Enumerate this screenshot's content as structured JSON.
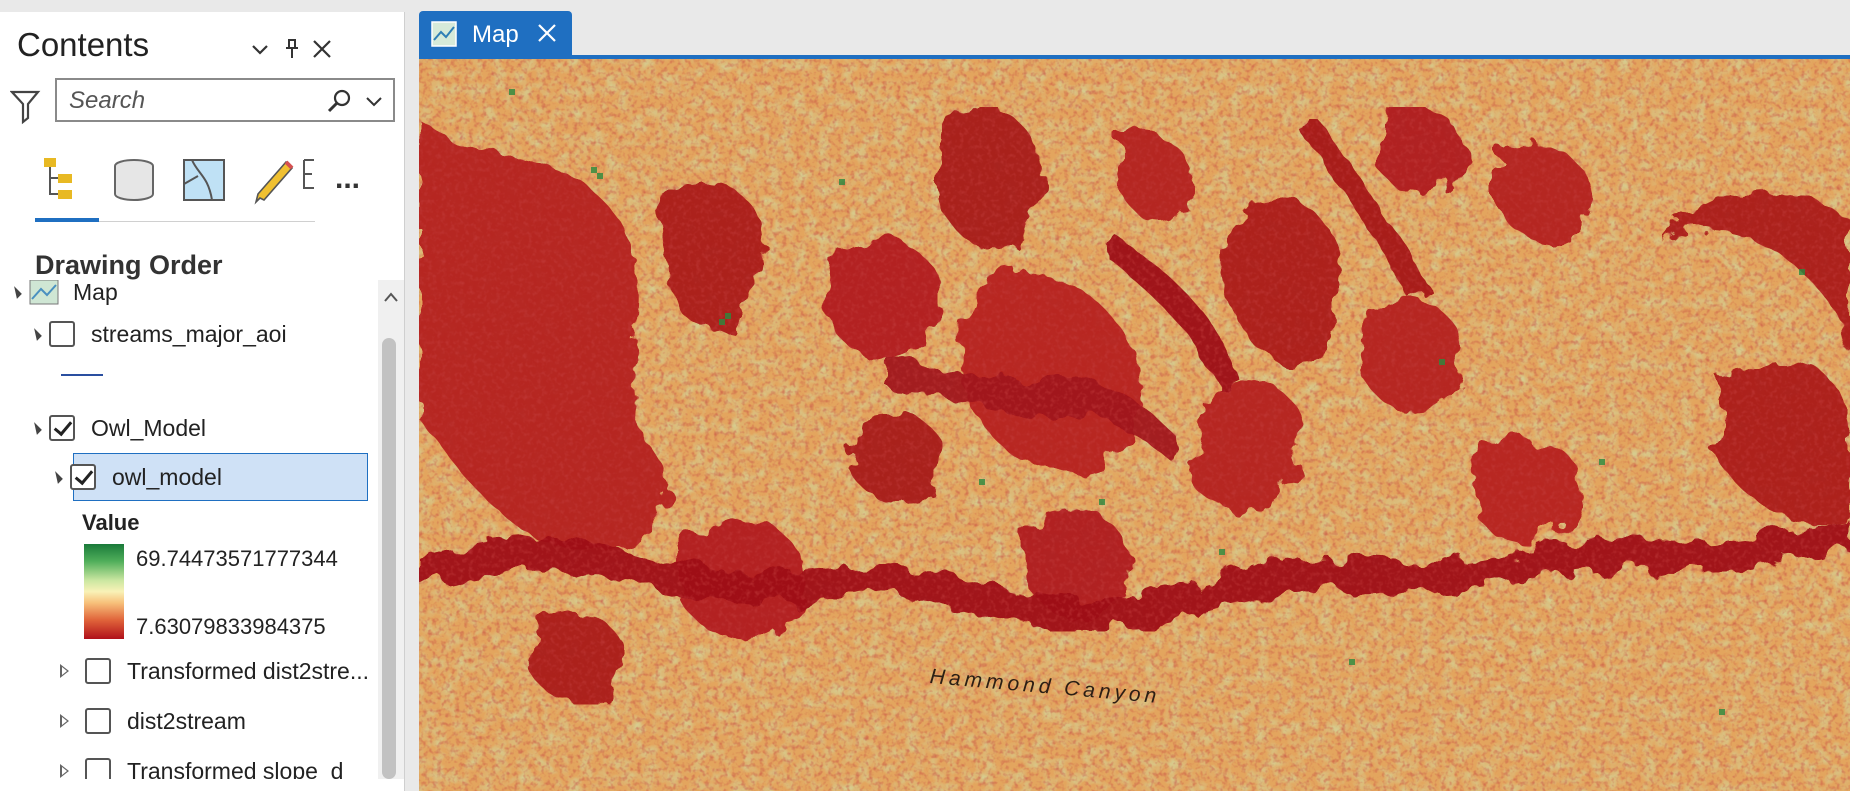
{
  "contents": {
    "title": "Contents",
    "search": {
      "placeholder": "Search",
      "value": ""
    },
    "section_title": "Drawing Order",
    "header_icons": [
      "chevron-down-icon",
      "pin-icon",
      "close-icon"
    ],
    "toolbar_icons": [
      "list-by-drawing-order-icon",
      "list-by-source-icon",
      "list-by-selection-icon",
      "list-by-editing-icon",
      "list-by-snapping-icon",
      "more-icon"
    ],
    "more_label": "...",
    "tree": {
      "map_label": "Map",
      "items": [
        {
          "label": "streams_major_aoi",
          "checked": false,
          "expanded": true
        },
        {
          "label": "Owl_Model",
          "checked": true,
          "expanded": true
        },
        {
          "label": "owl_model",
          "checked": true,
          "expanded": true,
          "selected": true
        },
        {
          "label": "Transformed dist2stre...",
          "checked": false,
          "expanded": false
        },
        {
          "label": "dist2stream",
          "checked": false,
          "expanded": false
        },
        {
          "label": "Transformed slope_d",
          "checked": false,
          "expanded": false
        }
      ],
      "legend": {
        "title": "Value",
        "high": "69.74473571777344",
        "low": "7.63079833984375"
      }
    },
    "colors": {
      "accent": "#1f6fc1",
      "selection": "#cfe1f6",
      "stream_line": "#2a4fa0"
    }
  },
  "map_tab": {
    "label": "Map"
  },
  "map": {
    "label": "Hammond Canyon",
    "colors": {
      "base": "#e3a55e",
      "high": "#1a7a3a",
      "mid": "#a8cf7a",
      "low": "#b0101a"
    }
  }
}
